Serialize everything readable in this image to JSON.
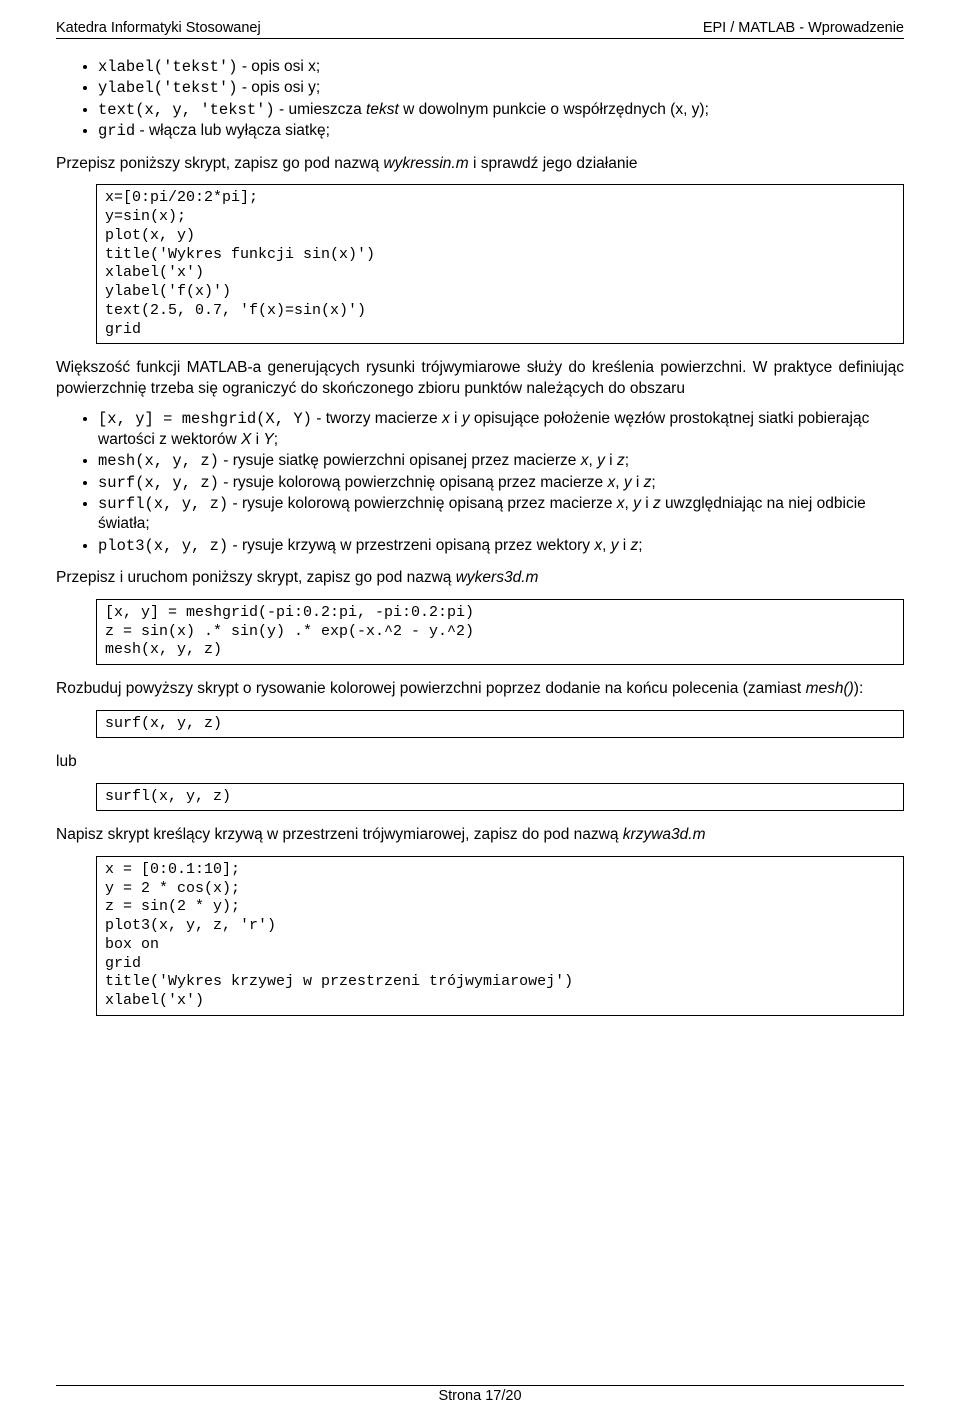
{
  "header": {
    "left": "Katedra Informatyki Stosowanej",
    "right": "EPI / MATLAB - Wprowadzenie"
  },
  "bullets1": {
    "i0": {
      "code": "xlabel('tekst')",
      "rest": " - opis osi x;"
    },
    "i1": {
      "code": "ylabel('tekst')",
      "rest": " - opis osi y;"
    },
    "i2": {
      "code": "text(x, y, 'tekst')",
      "mid": " - umieszcza ",
      "it": "tekst",
      "rest": " w dowolnym punkcie o współrzędnych (x, y);"
    },
    "i3": {
      "code": "grid",
      "rest": " - włącza lub wyłącza siatkę;"
    }
  },
  "para1": {
    "a": "Przepisz poniższy skrypt, zapisz go pod nazwą ",
    "it": "wykressin.m",
    "b": " i sprawdź jego działanie"
  },
  "code1": "x=[0:pi/20:2*pi];\ny=sin(x);\nplot(x, y)\ntitle('Wykres funkcji sin(x)')\nxlabel('x')\nylabel('f(x)')\ntext(2.5, 0.7, 'f(x)=sin(x)')\ngrid",
  "para2": "Większość funkcji MATLAB-a generujących rysunki trójwymiarowe służy do kreślenia powierzchni. W praktyce definiując powierzchnię trzeba się ograniczyć do skończonego zbioru punktów należących do obszaru",
  "bullets2": {
    "i0": {
      "code": "[x, y] = meshgrid(X, Y)",
      "mid": " - tworzy macierze ",
      "it1": "x",
      "t1": " i ",
      "it2": "y",
      "t2": " opisujące położenie węzłów prostokątnej siatki pobierając wartości z wektorów ",
      "it3": "X",
      "t3": " i ",
      "it4": "Y",
      "t4": ";"
    },
    "i1": {
      "code": "mesh(x, y, z)",
      "mid": " - rysuje siatkę powierzchni opisanej przez macierze ",
      "it1": "x",
      "t1": ", ",
      "it2": "y",
      "t2": " i ",
      "it3": "z",
      "t3": ";"
    },
    "i2": {
      "code": "surf(x, y, z)",
      "mid": " - rysuje kolorową powierzchnię opisaną przez macierze ",
      "it1": "x",
      "t1": ", ",
      "it2": "y",
      "t2": " i ",
      "it3": "z",
      "t3": ";"
    },
    "i3": {
      "code": "surfl(x, y, z)",
      "mid": " - rysuje kolorową powierzchnię opisaną przez macierze ",
      "it1": "x",
      "t1": ", ",
      "it2": "y",
      "t2": " i ",
      "it3": "z",
      "t3": " uwzględniając na niej odbicie światła;"
    },
    "i4": {
      "code": "plot3(x, y, z)",
      "mid": " - rysuje krzywą w przestrzeni opisaną przez wektory ",
      "it1": "x",
      "t1": ", ",
      "it2": "y",
      "t2": " i ",
      "it3": "z",
      "t3": ";"
    }
  },
  "para3": {
    "a": "Przepisz i uruchom poniższy skrypt, zapisz go pod nazwą ",
    "it": "wykers3d.m"
  },
  "code2": "[x, y] = meshgrid(-pi:0.2:pi, -pi:0.2:pi)\nz = sin(x) .* sin(y) .* exp(-x.^2 - y.^2)\nmesh(x, y, z)",
  "para4": {
    "a": "Rozbuduj powyższy skrypt o rysowanie kolorowej powierzchni poprzez dodanie na końcu polecenia (zamiast ",
    "it": "mesh()",
    "b": "):"
  },
  "code3": "surf(x, y, z)",
  "lub": "lub",
  "code4": "surfl(x, y, z)",
  "para5": {
    "a": "Napisz skrypt kreślący krzywą w przestrzeni trójwymiarowej, zapisz do pod nazwą ",
    "it": "krzywa3d.m"
  },
  "code5": "x = [0:0.1:10];\ny = 2 * cos(x);\nz = sin(2 * y);\nplot3(x, y, z, 'r')\nbox on\ngrid\ntitle('Wykres krzywej w przestrzeni trójwymiarowej')\nxlabel('x')",
  "footer": "Strona 17/20"
}
